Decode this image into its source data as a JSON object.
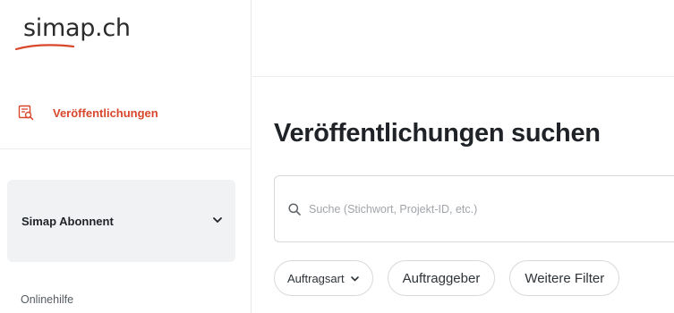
{
  "brand": {
    "logo_text": "simap.ch",
    "accent": "#d9472b"
  },
  "sidebar": {
    "nav": [
      {
        "label": "Veröffentlichungen",
        "icon": "publications-icon",
        "active": true
      }
    ],
    "subscriber": {
      "label": "Simap Abonnent",
      "icon": "chevron-down-icon"
    },
    "help_link": "Onlinehilfe"
  },
  "main": {
    "title": "Veröffentlichungen suchen",
    "search": {
      "placeholder": "Suche (Stichwort, Projekt-ID, etc.)",
      "value": "",
      "icon": "search-icon"
    },
    "filters": [
      {
        "label": "Auftragsart",
        "icon": "chevron-down-icon"
      },
      {
        "label": "Auftraggeber"
      },
      {
        "label": "Weitere Filter"
      }
    ]
  }
}
